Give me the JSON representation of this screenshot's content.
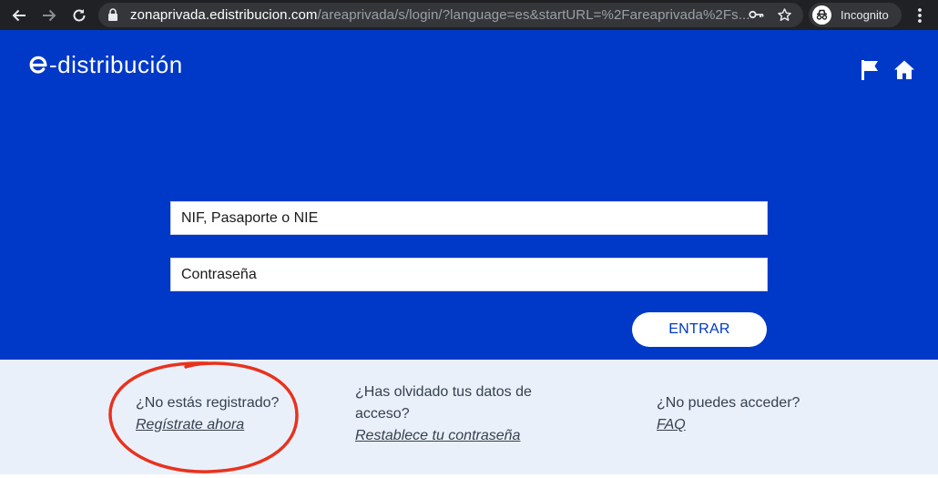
{
  "browser": {
    "url_host": "zonaprivada.edistribucion.com",
    "url_path": "/areaprivada/s/login/?language=es&startURL=%2Fareaprivada%2Fs...",
    "incognito_label": "Incognito",
    "icons": [
      "back-arrow-icon",
      "forward-arrow-icon",
      "reload-icon",
      "lock-icon",
      "key-icon",
      "star-icon",
      "incognito-icon",
      "more-vert-icon"
    ]
  },
  "header": {
    "logo_text": "-distribución",
    "icons": [
      "flag-icon",
      "home-icon"
    ]
  },
  "login": {
    "user_placeholder": "NIF, Pasaporte o NIE",
    "password_placeholder": "Contraseña",
    "submit_label": "ENTRAR"
  },
  "links": {
    "register_question": "¿No estás registrado?",
    "register_link": "Regístrate ahora",
    "forgot_question": "¿Has olvidado tus datos de acceso?",
    "forgot_link": "Restablece tu contraseña",
    "access_question": "¿No puedes acceder?",
    "access_link": "FAQ"
  },
  "colors": {
    "brand_blue": "#0038c8",
    "footer_bg": "#eaf0fa",
    "annotation_red": "#e8321e"
  }
}
